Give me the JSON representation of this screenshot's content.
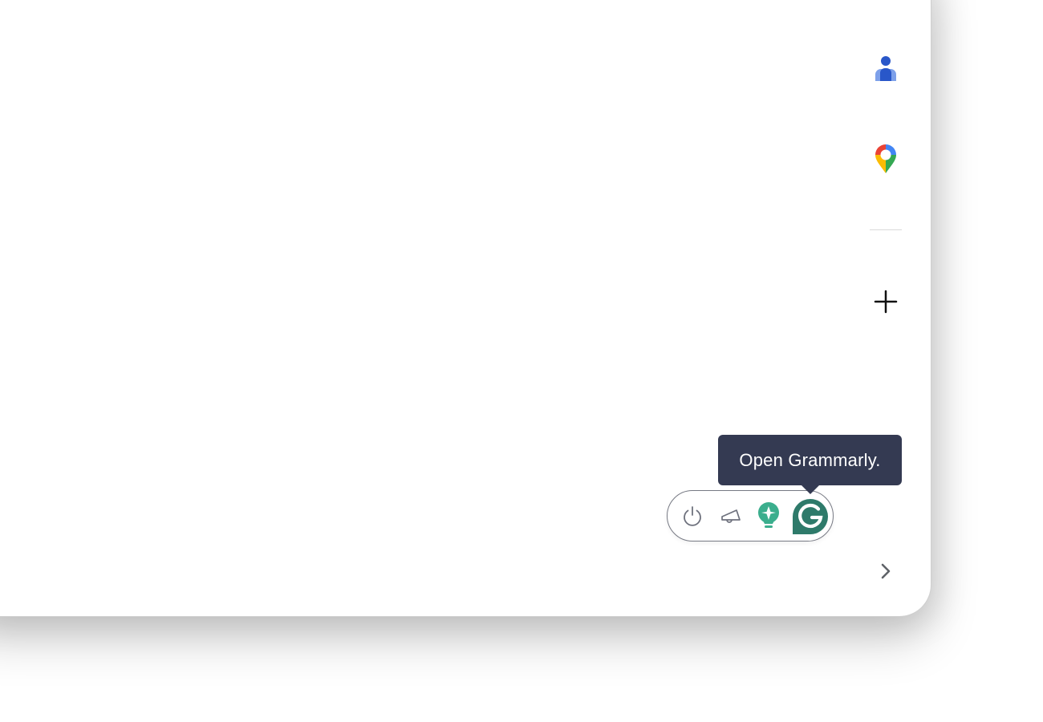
{
  "side_panel": {
    "icons": [
      {
        "name": "contacts-icon",
        "color": "#2957c9"
      },
      {
        "name": "maps-icon",
        "colors": [
          "#ea4335",
          "#4285f4",
          "#fbbc04",
          "#34a853"
        ]
      },
      {
        "name": "add-icon",
        "color": "#111111"
      },
      {
        "name": "chevron-right-icon",
        "color": "#5f6368"
      }
    ]
  },
  "grammarly_toolbar": {
    "buttons": [
      {
        "name": "power-icon"
      },
      {
        "name": "megaphone-icon"
      },
      {
        "name": "lightbulb-icon",
        "color": "#3bae8d"
      },
      {
        "name": "grammarly-logo-icon",
        "color": "#2e7a6a"
      }
    ],
    "tooltip": "Open Grammarly."
  },
  "colors": {
    "tooltip_bg": "#343a52",
    "grammarly_green": "#2e7a6a"
  }
}
